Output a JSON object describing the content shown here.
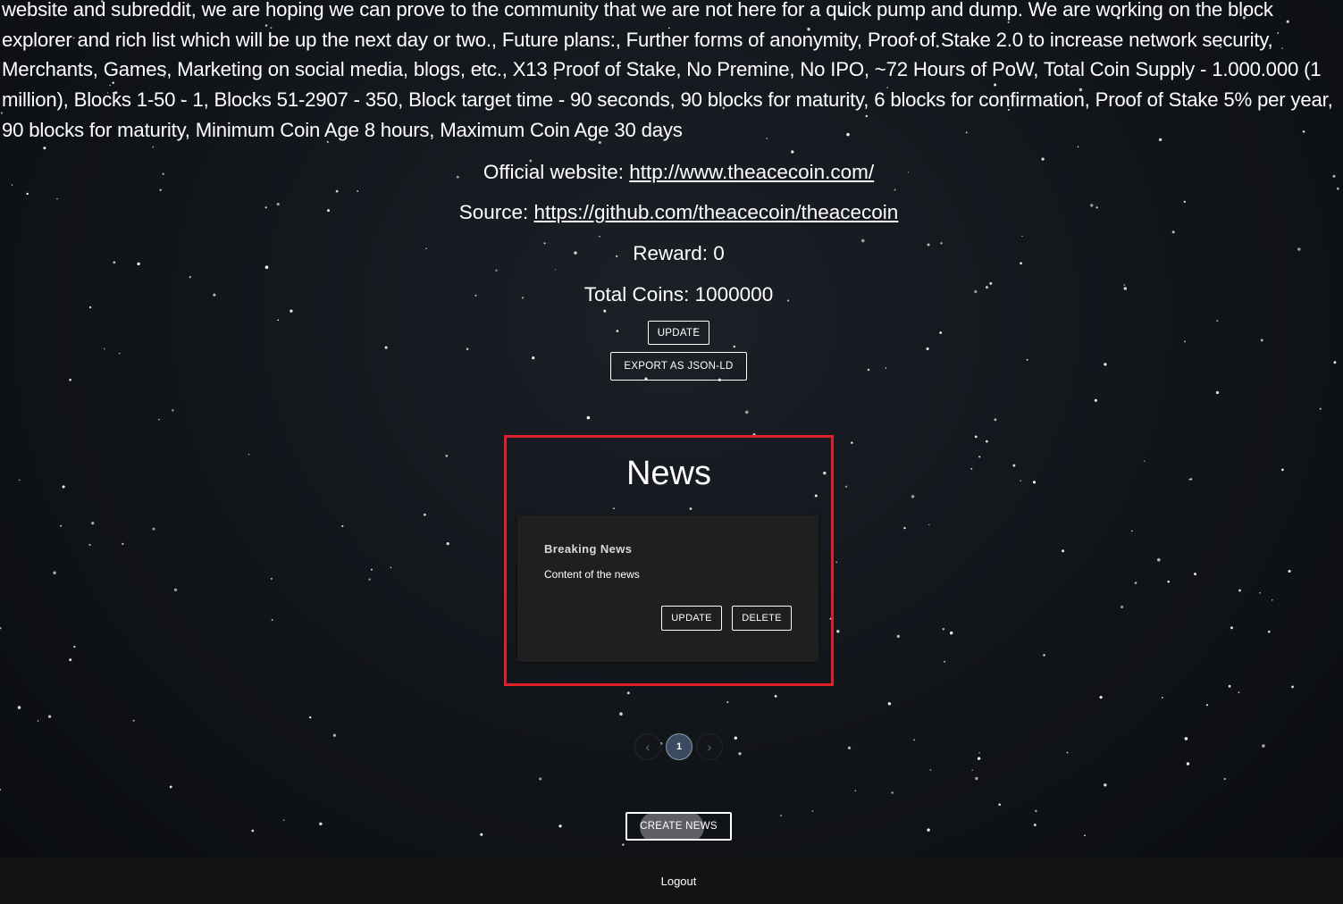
{
  "coin": {
    "description": "website and subreddit, we are hoping we can prove to the community that we are not here for a quick pump and dump. We are working on the block explorer and rich list which will be up the next day or two., Future plans:, Further forms of anonymity, Proof of Stake 2.0 to increase network security, Merchants, Games, Marketing on social media, blogs, etc., X13 Proof of Stake, No Premine, No IPO, ~72 Hours of PoW, Total Coin Supply - 1.000.000 (1 million), Blocks 1-50 - 1, Blocks 51-2907 - 350, Block target time - 90 seconds, 90 blocks for maturity, 6 blocks for confirmation, Proof of Stake 5% per year, 90 blocks for maturity, Minimum Coin Age 8 hours, Maximum Coin Age 30 days",
    "website_label": "Official website:",
    "website_url": "http://www.theacecoin.com/",
    "source_label": "Source:",
    "source_url": "https://github.com/theacecoin/theacecoin",
    "reward_label": "Reward:",
    "reward_value": "0",
    "total_coins_label": "Total Coins:",
    "total_coins_value": "1000000",
    "update_label": "UPDATE",
    "export_label": "EXPORT AS JSON-LD"
  },
  "news": {
    "heading": "News",
    "items": [
      {
        "title": "Breaking News",
        "content": "Content of the news",
        "update_label": "UPDATE",
        "delete_label": "DELETE"
      }
    ],
    "pagination": {
      "prev_icon": "chevron-left-icon",
      "next_icon": "chevron-right-icon",
      "current_page": "1"
    },
    "create_label": "CREATE NEWS"
  },
  "footer": {
    "logout_label": "Logout"
  },
  "colors": {
    "highlight_border": "#e0202a",
    "card_background": "#1f1f1f",
    "footer_background": "#131313",
    "page_current": "#3a4a60"
  }
}
